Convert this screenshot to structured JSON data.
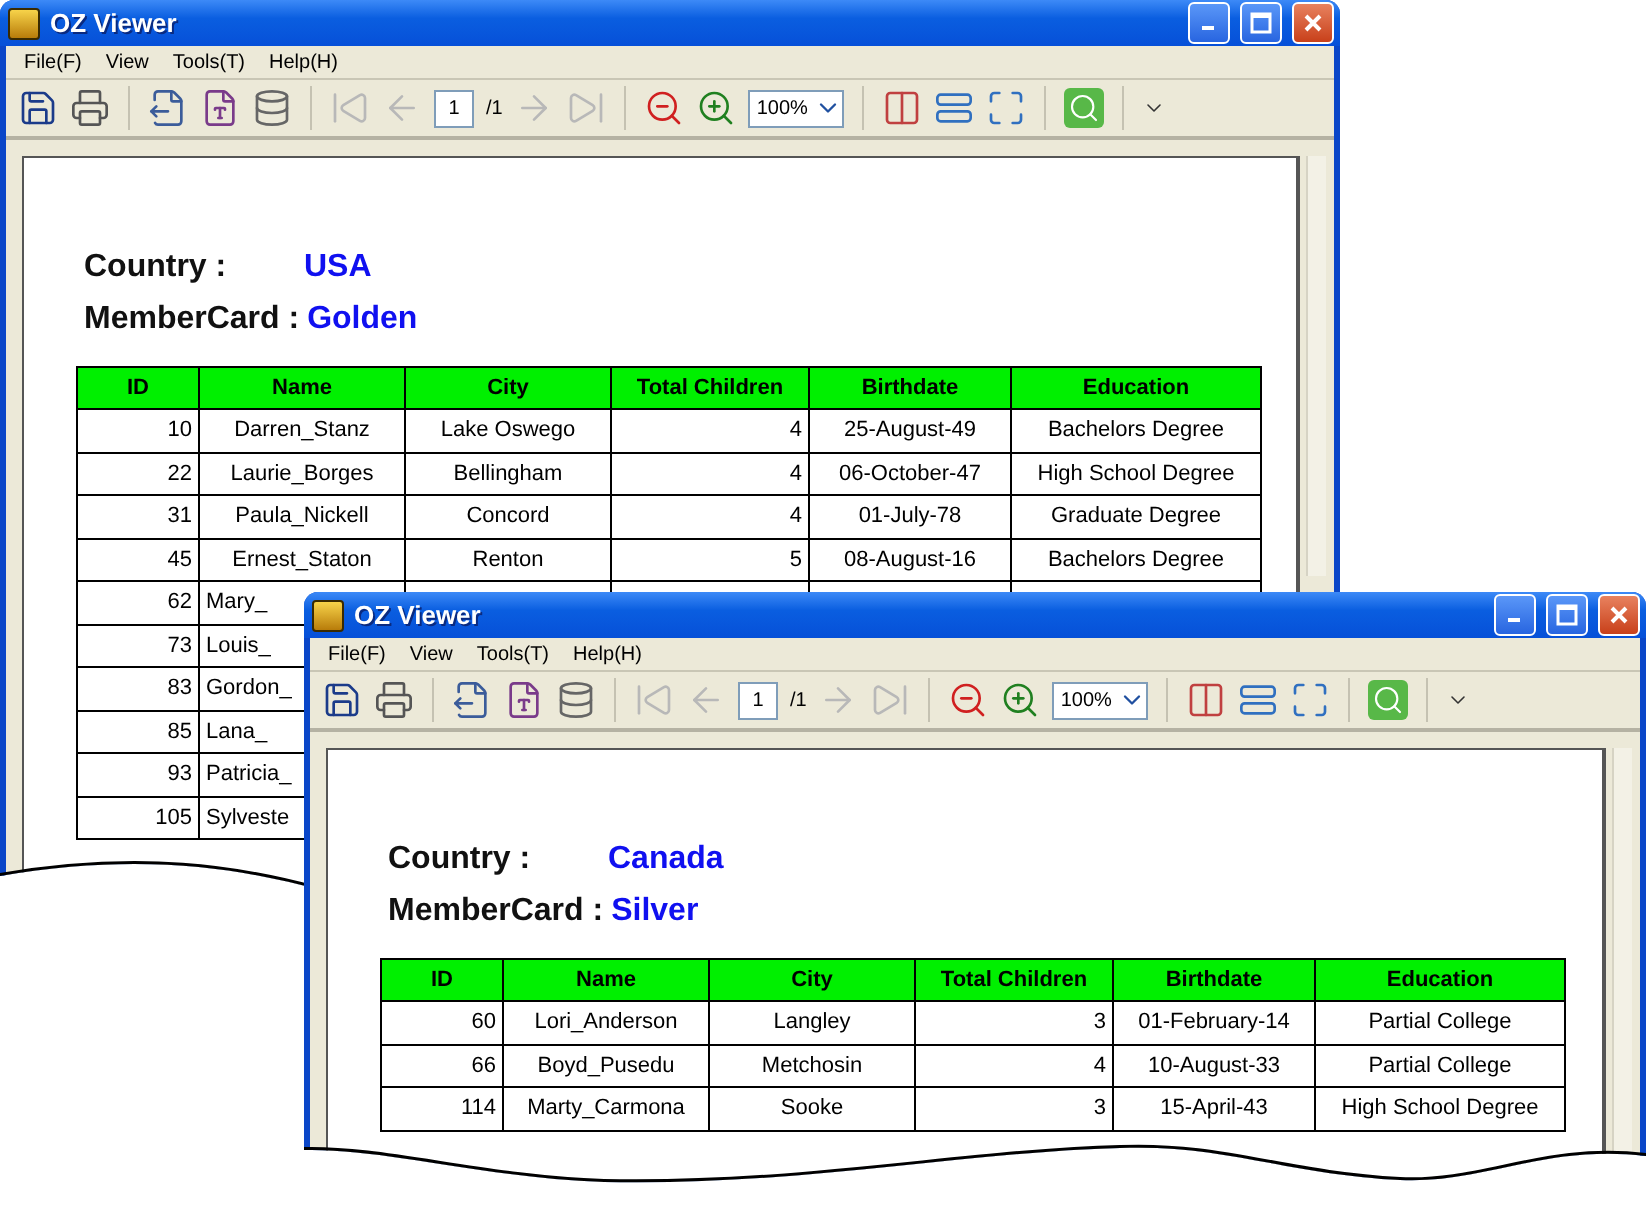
{
  "windows": [
    {
      "title": "OZ Viewer",
      "menu": [
        "File(F)",
        "View",
        "Tools(T)",
        "Help(H)"
      ],
      "toolbar": {
        "page": "1",
        "page_total": "/1",
        "zoom": "100%"
      },
      "report": {
        "country_label": "Country :",
        "country": "USA",
        "membercard_label": "MemberCard :",
        "membercard": "Golden",
        "columns": [
          "ID",
          "Name",
          "City",
          "Total Children",
          "Birthdate",
          "Education"
        ],
        "rows": [
          [
            "10",
            "Darren_Stanz",
            "Lake Oswego",
            "4",
            "25-August-49",
            "Bachelors Degree"
          ],
          [
            "22",
            "Laurie_Borges",
            "Bellingham",
            "4",
            "06-October-47",
            "High School Degree"
          ],
          [
            "31",
            "Paula_Nickell",
            "Concord",
            "4",
            "01-July-78",
            "Graduate Degree"
          ],
          [
            "45",
            "Ernest_Staton",
            "Renton",
            "5",
            "08-August-16",
            "Bachelors Degree"
          ],
          [
            "62",
            "Mary_"
          ],
          [
            "73",
            "Louis_"
          ],
          [
            "83",
            "Gordon_"
          ],
          [
            "85",
            "Lana_"
          ],
          [
            "93",
            "Patricia_"
          ],
          [
            "105",
            "Sylveste"
          ]
        ]
      }
    },
    {
      "title": "OZ Viewer",
      "menu": [
        "File(F)",
        "View",
        "Tools(T)",
        "Help(H)"
      ],
      "toolbar": {
        "page": "1",
        "page_total": "/1",
        "zoom": "100%"
      },
      "report": {
        "country_label": "Country :",
        "country": "Canada",
        "membercard_label": "MemberCard :",
        "membercard": "Silver",
        "columns": [
          "ID",
          "Name",
          "City",
          "Total Children",
          "Birthdate",
          "Education"
        ],
        "rows": [
          [
            "60",
            "Lori_Anderson",
            "Langley",
            "3",
            "01-February-14",
            "Partial College"
          ],
          [
            "66",
            "Boyd_Pusedu",
            "Metchosin",
            "4",
            "10-August-33",
            "Partial College"
          ],
          [
            "114",
            "Marty_Carmona",
            "Sooke",
            "3",
            "15-April-43",
            "High School Degree"
          ]
        ]
      }
    }
  ]
}
